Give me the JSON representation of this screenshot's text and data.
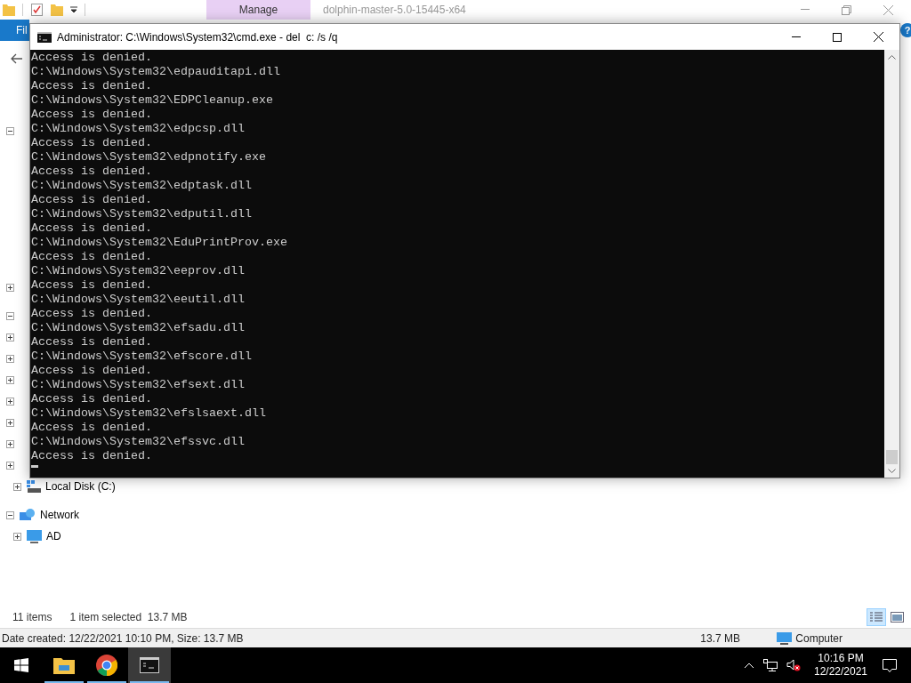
{
  "explorer": {
    "manage_tab": "Manage",
    "title": "dolphin-master-5.0-15445-x64",
    "file_tab": "Fil",
    "help": "?",
    "hidden_expanders": [
      {
        "expanded": true
      },
      {
        "expanded": false
      },
      {
        "expanded": true
      },
      {
        "expanded": false
      },
      {
        "expanded": false
      },
      {
        "expanded": false
      },
      {
        "expanded": false
      },
      {
        "expanded": false
      },
      {
        "expanded": false
      },
      {
        "expanded": false
      }
    ],
    "tree": [
      {
        "label": "Local Disk (C:)",
        "kind": "drive",
        "expanded": false
      },
      {
        "label": "Network",
        "kind": "network",
        "expanded": true,
        "children": [
          {
            "label": "AD",
            "kind": "computer",
            "expanded": false
          }
        ]
      }
    ],
    "status": {
      "count": "11 items",
      "selection": "1 item selected  13.7 MB"
    },
    "details": {
      "text": "Date created: 12/22/2021 10:10 PM, Size: 13.7 MB",
      "size": "13.7 MB",
      "location": "Computer"
    }
  },
  "cmd": {
    "title": "Administrator: C:\\Windows\\System32\\cmd.exe - del  c: /s /q",
    "lines": [
      "Access is denied.",
      "C:\\Windows\\System32\\edpauditapi.dll",
      "Access is denied.",
      "C:\\Windows\\System32\\EDPCleanup.exe",
      "Access is denied.",
      "C:\\Windows\\System32\\edpcsp.dll",
      "Access is denied.",
      "C:\\Windows\\System32\\edpnotify.exe",
      "Access is denied.",
      "C:\\Windows\\System32\\edptask.dll",
      "Access is denied.",
      "C:\\Windows\\System32\\edputil.dll",
      "Access is denied.",
      "C:\\Windows\\System32\\EduPrintProv.exe",
      "Access is denied.",
      "C:\\Windows\\System32\\eeprov.dll",
      "Access is denied.",
      "C:\\Windows\\System32\\eeutil.dll",
      "Access is denied.",
      "C:\\Windows\\System32\\efsadu.dll",
      "Access is denied.",
      "C:\\Windows\\System32\\efscore.dll",
      "Access is denied.",
      "C:\\Windows\\System32\\efsext.dll",
      "Access is denied.",
      "C:\\Windows\\System32\\efslsaext.dll",
      "Access is denied.",
      "C:\\Windows\\System32\\efssvc.dll",
      "Access is denied."
    ]
  },
  "taskbar": {
    "apps": [
      {
        "kind": "explorer",
        "selected": false
      },
      {
        "kind": "chrome",
        "selected": false
      },
      {
        "kind": "cmd",
        "selected": true
      }
    ],
    "time": "10:16 PM",
    "date": "12/22/2021"
  }
}
